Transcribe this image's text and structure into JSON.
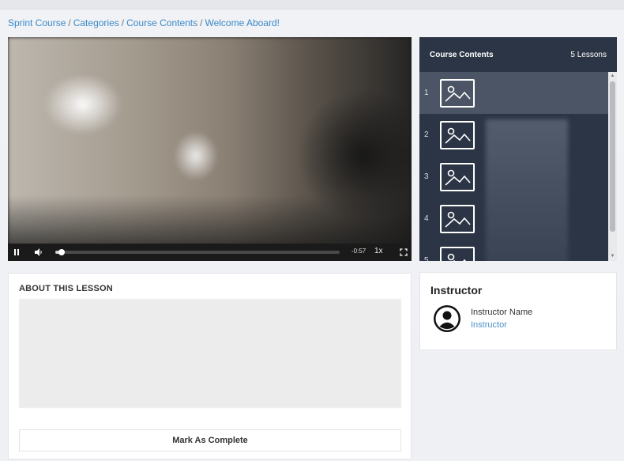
{
  "breadcrumb": {
    "items": [
      "Sprint Course",
      "Categories",
      "Course Contents",
      "Welcome Aboard!"
    ],
    "separator": "/"
  },
  "player": {
    "time_remaining": "-0:57",
    "speed": "1x",
    "progress": 0.02,
    "icons": {
      "play_pause": "pause-icon",
      "volume": "volume-icon",
      "fullscreen": "fullscreen-icon"
    }
  },
  "course_contents": {
    "title": "Course Contents",
    "lesson_count": "5 Lessons",
    "lessons": [
      {
        "number": "1",
        "active": true
      },
      {
        "number": "2",
        "active": false
      },
      {
        "number": "3",
        "active": false
      },
      {
        "number": "4",
        "active": false
      },
      {
        "number": "5",
        "active": false
      }
    ]
  },
  "about": {
    "heading": "ABOUT THIS LESSON",
    "complete_label": "Mark As Complete"
  },
  "instructor": {
    "heading": "Instructor",
    "name": "Instructor Name",
    "role": "Instructor"
  },
  "colors": {
    "link": "#3b89c9",
    "sidebar_bg": "#2c3545",
    "active_lesson": "#4b5566"
  }
}
